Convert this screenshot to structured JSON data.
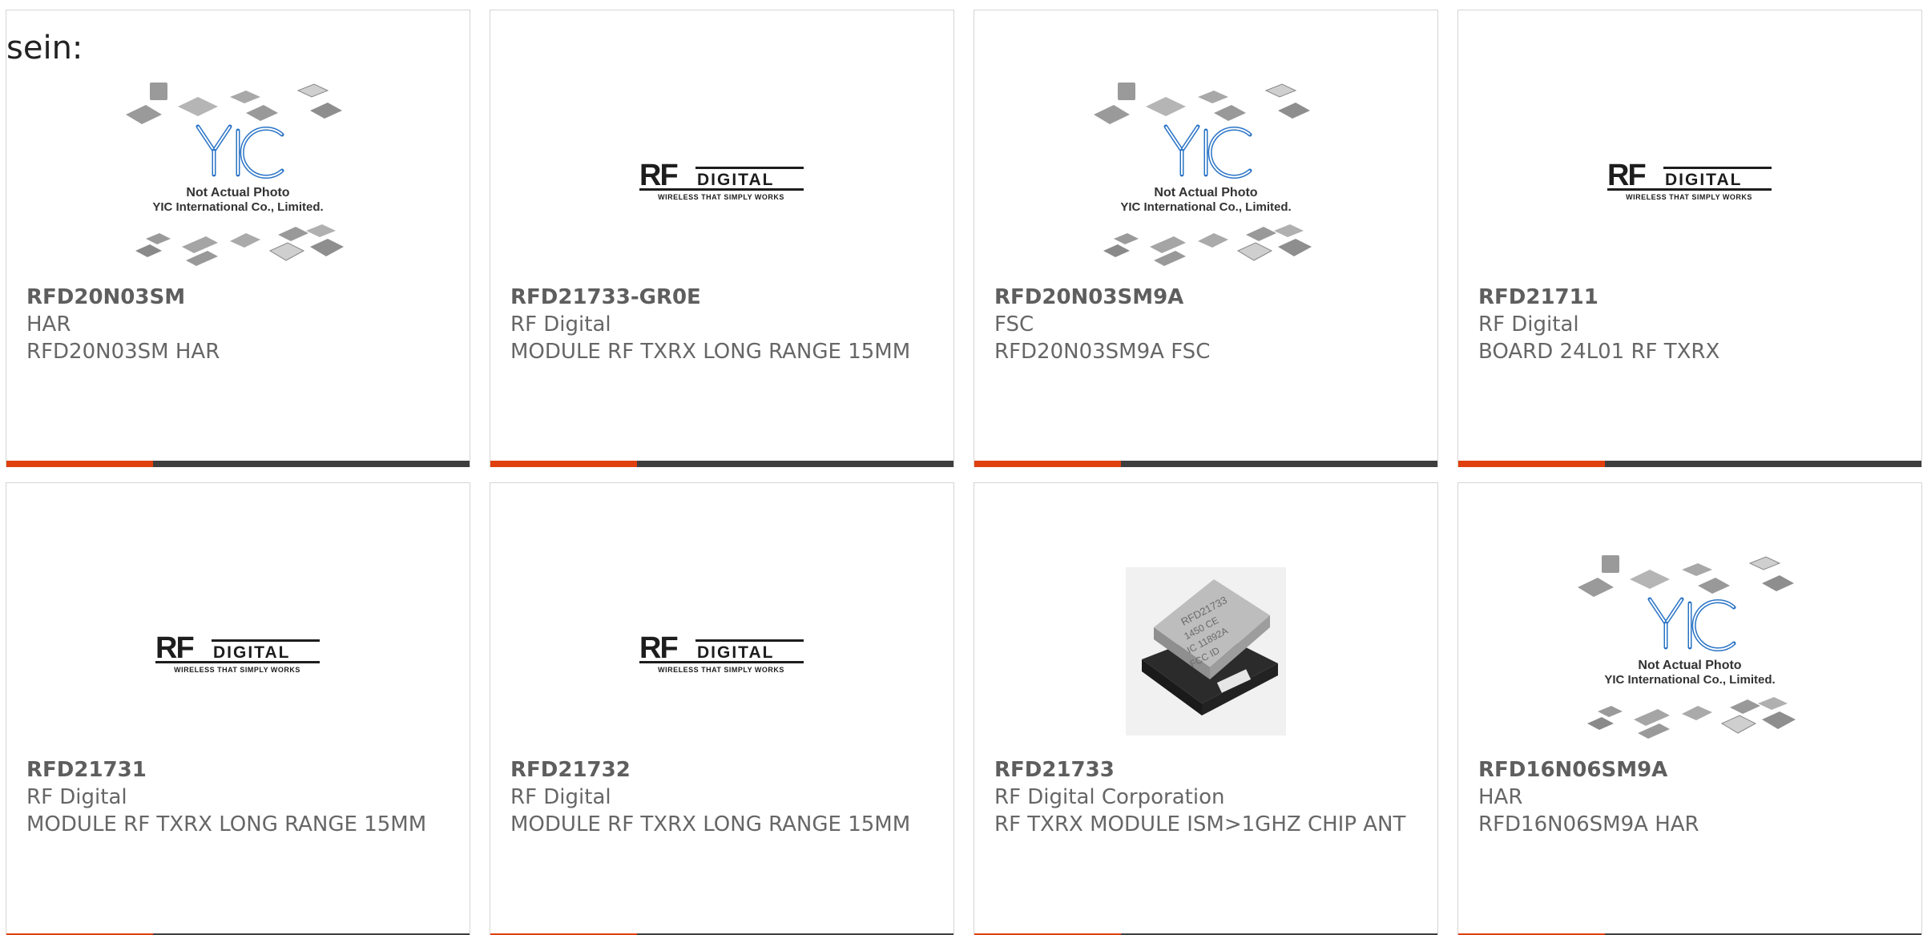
{
  "caption": "sein:",
  "placeholder_text": {
    "line1": "Not Actual Photo",
    "line2": "YIC International Co., Limited."
  },
  "brand_logo": {
    "word1": "RF",
    "word2": "DIGITAL",
    "tagline": "WIRELESS THAT SIMPLY WORKS"
  },
  "colors": {
    "accent": "#e0400e",
    "bar": "#3e3e3e",
    "border": "#d5d5d5",
    "text": "#666666",
    "yic_blue": "#1e6fc1"
  },
  "products": [
    {
      "part": "RFD20N03SM",
      "maker": "HAR",
      "desc": "RFD20N03SM HAR",
      "image": "yic-placeholder"
    },
    {
      "part": "RFD21733-GR0E",
      "maker": "RF Digital",
      "desc": "MODULE RF TXRX LONG RANGE 15MM",
      "image": "rf-digital-logo"
    },
    {
      "part": "RFD20N03SM9A",
      "maker": "FSC",
      "desc": "RFD20N03SM9A FSC",
      "image": "yic-placeholder"
    },
    {
      "part": "RFD21711",
      "maker": "RF Digital",
      "desc": "BOARD 24L01 RF TXRX",
      "image": "rf-digital-logo"
    },
    {
      "part": "RFD21731",
      "maker": "RF Digital",
      "desc": "MODULE RF TXRX LONG RANGE 15MM",
      "image": "rf-digital-logo"
    },
    {
      "part": "RFD21732",
      "maker": "RF Digital",
      "desc": "MODULE RF TXRX LONG RANGE 15MM",
      "image": "rf-digital-logo"
    },
    {
      "part": "RFD21733",
      "maker": "RF Digital Corporation",
      "desc": "RF TXRX MODULE ISM>1GHZ CHIP ANT",
      "image": "rf-module-photo"
    },
    {
      "part": "RFD16N06SM9A",
      "maker": "HAR",
      "desc": "RFD16N06SM9A HAR",
      "image": "yic-placeholder"
    }
  ]
}
